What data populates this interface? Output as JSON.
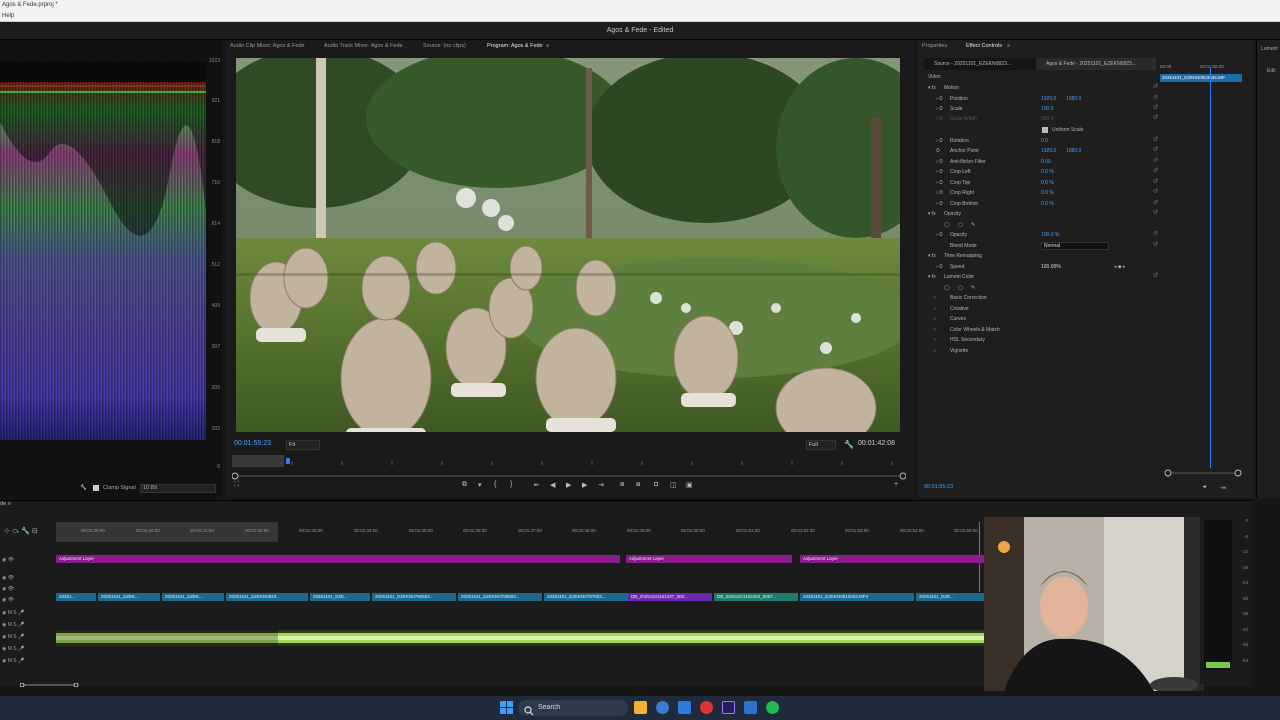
{
  "os": {
    "title": "Agos & Fede.prproj *",
    "menu": "Help"
  },
  "app": {
    "title": "Agos & Fede - Edited"
  },
  "scope": {
    "scale": [
      "1023",
      "921",
      "818",
      "716",
      "614",
      "512",
      "409",
      "307",
      "205",
      "102",
      "0"
    ],
    "clamp_label": "Clamp Signal",
    "bit_depth": "10 Bit"
  },
  "program": {
    "tabs": [
      "Audio Clip Mixer: Agos & Fede",
      "Audio Track Mixer: Agos & Fede",
      "Source: (no clips)",
      "Program: Agos & Fede"
    ],
    "active_tab": "Program: Agos & Fede",
    "timecode_current": "00:01:55:23",
    "fit": "Fit",
    "resolution": "Full",
    "timecode_duration": "00:01:42:08"
  },
  "effect_controls": {
    "tabs": [
      "Properties",
      "Effect Controls"
    ],
    "source_label": "Source - 20251101_EZEKN0823...",
    "sequence_label": "Agos & Fede - 20251101_EZEKN0823...",
    "mini_ruler": [
      "55:00",
      "00:01:56:00"
    ],
    "clip_name": "20251101_EZEKN0823505.MP",
    "section": "Video",
    "rows": [
      {
        "label": "Motion",
        "value": "",
        "value2": ""
      },
      {
        "label": "Position",
        "value": "1920.0",
        "value2": "1080.0"
      },
      {
        "label": "Scale",
        "value": "100.0",
        "value2": ""
      },
      {
        "label": "Scale Width",
        "value": "100.0",
        "value2": ""
      },
      {
        "label": "Uniform Scale",
        "value": "",
        "value2": ""
      },
      {
        "label": "Rotation",
        "value": "0.0",
        "value2": ""
      },
      {
        "label": "Anchor Point",
        "value": "1920.0",
        "value2": "1080.0"
      },
      {
        "label": "Anti-flicker Filter",
        "value": "0.00",
        "value2": ""
      },
      {
        "label": "Crop Left",
        "value": "0.0 %",
        "value2": ""
      },
      {
        "label": "Crop Top",
        "value": "0.0 %",
        "value2": ""
      },
      {
        "label": "Crop Right",
        "value": "0.0 %",
        "value2": ""
      },
      {
        "label": "Crop Bottom",
        "value": "0.0 %",
        "value2": ""
      },
      {
        "label": "Opacity",
        "value": "",
        "value2": ""
      },
      {
        "label": "",
        "value": "",
        "value2": ""
      },
      {
        "label": "Opacity",
        "value": "100.0 %",
        "value2": ""
      },
      {
        "label": "Blend Mode",
        "value": "Normal",
        "value2": ""
      },
      {
        "label": "Time Remapping",
        "value": "",
        "value2": ""
      },
      {
        "label": "Speed",
        "value": "100.00%",
        "value2": ""
      },
      {
        "label": "Lumetri Color",
        "value": "",
        "value2": ""
      },
      {
        "label": "",
        "value": "",
        "value2": ""
      },
      {
        "label": "Basic Correction",
        "value": "",
        "value2": ""
      },
      {
        "label": "Creative",
        "value": "",
        "value2": ""
      },
      {
        "label": "Curves",
        "value": "",
        "value2": ""
      },
      {
        "label": "Color Wheels & Match",
        "value": "",
        "value2": ""
      },
      {
        "label": "HSL Secondary",
        "value": "",
        "value2": ""
      },
      {
        "label": "Vignette",
        "value": "",
        "value2": ""
      }
    ],
    "timecode": "00:01:55:23"
  },
  "lumetri": {
    "tab": "Lumetri",
    "edit": "Edit"
  },
  "timeline": {
    "ruler": [
      "00:01:39:00",
      "00:01:40:00",
      "00:01:41:00",
      "00:01:42:00",
      "00:01:43:00",
      "00:01:44:00",
      "00:01:45:00",
      "00:01:46:00",
      "00:01:47:00",
      "00:01:48:00",
      "00:01:49:00",
      "00:01:50:00",
      "00:01:51:00",
      "00:01:52:00",
      "00:01:53:00",
      "00:01:54:00",
      "00:01:55:00"
    ],
    "adjustment_clips": [
      "Adjustment Layer",
      "Adjustment Layer",
      "Adjustment Layer"
    ],
    "video_clips": [
      "20251...",
      "20251101_EZEK...",
      "20251101_EZEK...",
      "20251101_EZEKN0823...",
      "20251101_EZE...",
      "20251101_EZEKN0790503...",
      "20251101_EZEKN0788503...",
      "20251101_EZEKN0787503...",
      "DB_20251101161437_003...",
      "DB_20251101163453_0057...",
      "20251101_EZEKN0815503.MP4",
      "20251101_EZE..."
    ],
    "meter_scale": [
      "0",
      "-6",
      "-12",
      "-18",
      "-24",
      "-30",
      "-36",
      "-42",
      "-48",
      "-54"
    ]
  },
  "taskbar": {
    "search_placeholder": "Search"
  }
}
